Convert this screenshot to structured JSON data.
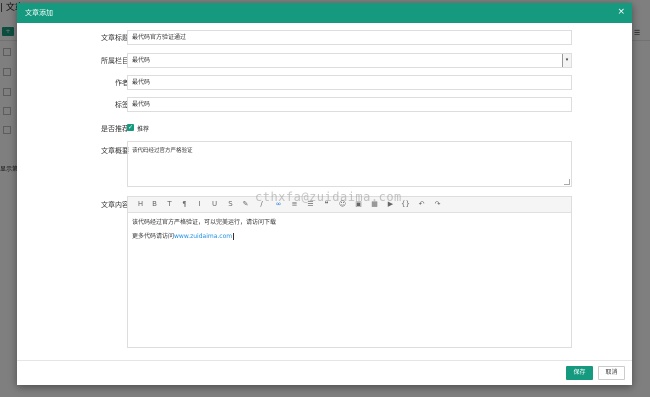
{
  "background": {
    "page_title": "| 文章",
    "add_button": "+ 新",
    "hint_text": "显示第",
    "menu_icon": "hamburger-menu-icon"
  },
  "modal": {
    "title": "文章添加",
    "close_icon": "close-x-icon",
    "close_glyph": "×",
    "fields": {
      "title": {
        "label": "文章标题",
        "value": "最代码官方验证通过"
      },
      "category": {
        "label": "所属栏目",
        "value": "最代码",
        "arrow": "▾"
      },
      "author": {
        "label": "作者",
        "value": "最代码"
      },
      "tags": {
        "label": "标签",
        "value": "最代码"
      },
      "recommend": {
        "label": "是否推荐",
        "checkbox_label": "推荐",
        "checked": true
      },
      "summary": {
        "label": "文章概要",
        "value": "该代码经过官方严格验证"
      },
      "content": {
        "label": "文章内容",
        "toolbar": [
          {
            "name": "heading-icon",
            "glyph": "H"
          },
          {
            "name": "bold-icon",
            "glyph": "B"
          },
          {
            "name": "text-size-icon",
            "glyph": "T"
          },
          {
            "name": "paragraph-icon",
            "glyph": "¶"
          },
          {
            "name": "italic-icon",
            "glyph": "I"
          },
          {
            "name": "underline-icon",
            "glyph": "U"
          },
          {
            "name": "strikethrough-icon",
            "glyph": "S"
          },
          {
            "name": "brush-icon",
            "glyph": "✎"
          },
          {
            "name": "pen-icon",
            "glyph": "/"
          },
          {
            "name": "link-icon",
            "glyph": "∞"
          },
          {
            "name": "ordered-list-icon",
            "glyph": "≡"
          },
          {
            "name": "unordered-list-icon",
            "glyph": "☰"
          },
          {
            "name": "quote-icon",
            "glyph": "❝"
          },
          {
            "name": "emoji-icon",
            "glyph": "☺"
          },
          {
            "name": "image-icon",
            "glyph": "▣"
          },
          {
            "name": "table-icon",
            "glyph": "▦"
          },
          {
            "name": "video-icon",
            "glyph": "▶"
          },
          {
            "name": "code-icon",
            "glyph": "{}"
          },
          {
            "name": "undo-icon",
            "glyph": "↶"
          },
          {
            "name": "redo-icon",
            "glyph": "↷"
          }
        ],
        "line1": "该代码经过官方严格验证，可以完美运行，请访问下载",
        "line2_prefix": "更多代码请访问",
        "line2_link": "www.zuidaima.com"
      }
    },
    "watermark": "cthxfa@zuidaima.com",
    "buttons": {
      "save": "保存",
      "cancel": "取消"
    }
  },
  "colors": {
    "accent": "#159a80",
    "link": "#1a8fe0"
  }
}
